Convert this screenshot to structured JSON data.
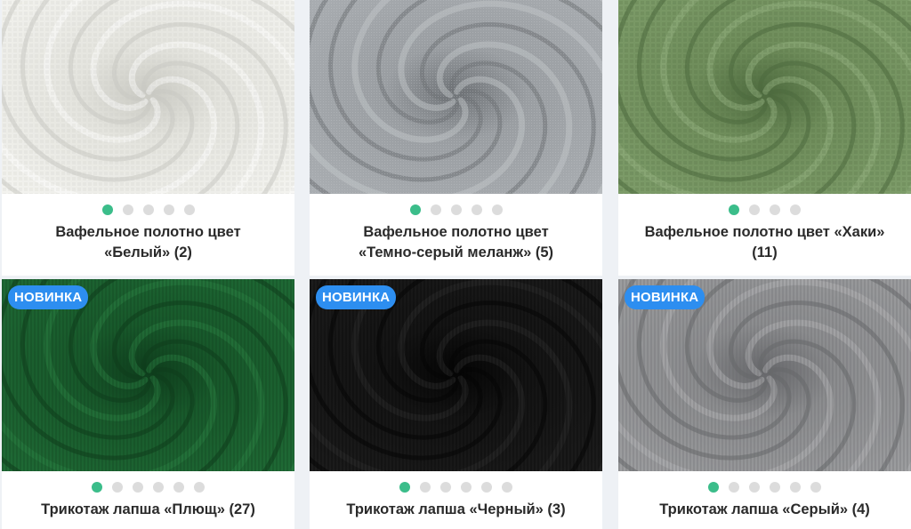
{
  "products": [
    {
      "line1": "Вафельное полотно цвет",
      "line2": "«Белый» (2)",
      "badge": "",
      "dots": 5,
      "active_dot": 0,
      "colors": {
        "base": "#f3f3ef",
        "mid": "#e4e4de",
        "shade": "#c9c9c2",
        "light": "#ffffff"
      },
      "pattern": "waffle"
    },
    {
      "line1": "Вафельное полотно цвет",
      "line2": "«Темно-серый меланж» (5)",
      "badge": "",
      "dots": 5,
      "active_dot": 0,
      "colors": {
        "base": "#a9adb1",
        "mid": "#9a9ea2",
        "shade": "#6f7377",
        "light": "#c6c9cc"
      },
      "pattern": "melange"
    },
    {
      "line1": "Вафельное полотно цвет «Хаки»",
      "line2": "(11)",
      "badge": "",
      "dots": 4,
      "active_dot": 0,
      "colors": {
        "base": "#7d9c69",
        "mid": "#6f8d5b",
        "shade": "#4d6a3e",
        "light": "#98b585"
      },
      "pattern": "waffle"
    },
    {
      "line1": "Трикотаж лапша «Плющ» (27)",
      "line2": "",
      "badge": "НОВИНКА",
      "dots": 6,
      "active_dot": 0,
      "colors": {
        "base": "#1f6a35",
        "mid": "#18592b",
        "shade": "#0e3d1c",
        "light": "#2c8244"
      },
      "pattern": "rib"
    },
    {
      "line1": "Трикотаж лапша «Черный» (3)",
      "line2": "",
      "badge": "НОВИНКА",
      "dots": 6,
      "active_dot": 0,
      "colors": {
        "base": "#1c1c1c",
        "mid": "#141414",
        "shade": "#050505",
        "light": "#2e2e2e"
      },
      "pattern": "rib"
    },
    {
      "line1": "Трикотаж лапша «Серый» (4)",
      "line2": "",
      "badge": "НОВИНКА",
      "dots": 6,
      "active_dot": 0,
      "colors": {
        "base": "#9c9d9f",
        "mid": "#8c8d8f",
        "shade": "#66676a",
        "light": "#b8b9bb"
      },
      "pattern": "rib"
    }
  ]
}
